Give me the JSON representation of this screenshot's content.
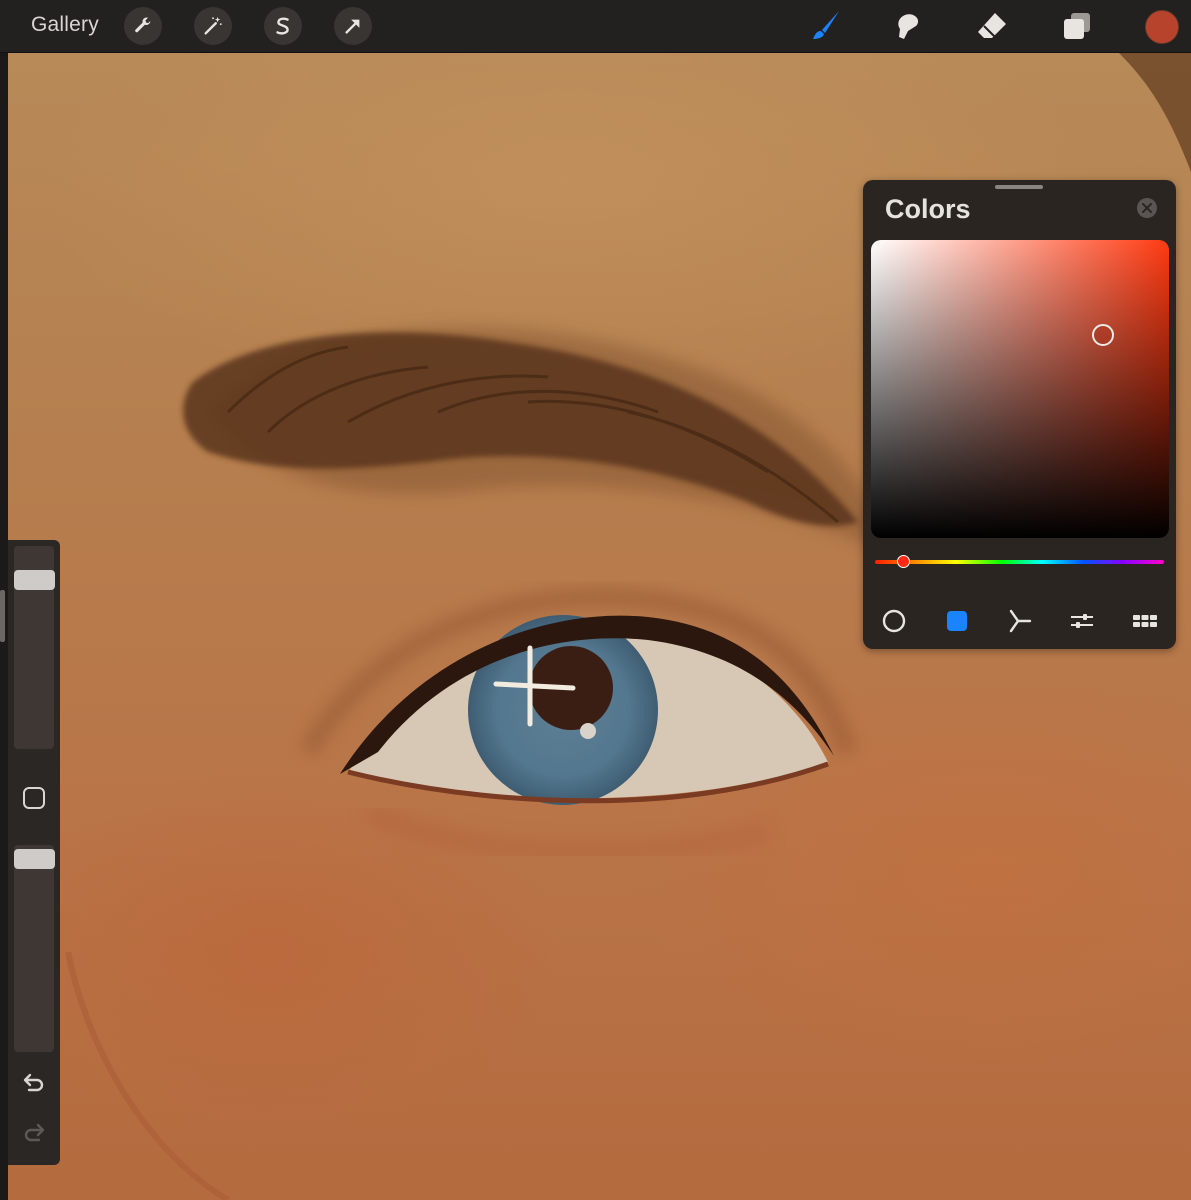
{
  "toolbar": {
    "gallery_label": "Gallery",
    "left_tools": [
      "wrench-icon",
      "magic-wand-icon",
      "selection-s-icon",
      "move-arrow-icon"
    ],
    "right_tools": [
      "brush-icon",
      "smudge-icon",
      "eraser-icon",
      "layers-icon"
    ],
    "active_tool": "brush-icon",
    "accent_color": "#1a84ff",
    "current_color": "#b8432c"
  },
  "sidebar": {
    "brush_size_level": 0.05,
    "opacity_level": 0.03,
    "controls": [
      "modify-square-icon",
      "undo-icon",
      "redo-icon"
    ]
  },
  "colors_panel": {
    "title": "Colors",
    "hue_value": 0.03,
    "saturation": 0.78,
    "brightness": 0.68,
    "modes": [
      "disc-mode-icon",
      "classic-mode-icon",
      "harmony-mode-icon",
      "value-mode-icon",
      "palettes-mode-icon"
    ],
    "active_mode": "classic-mode-icon"
  }
}
